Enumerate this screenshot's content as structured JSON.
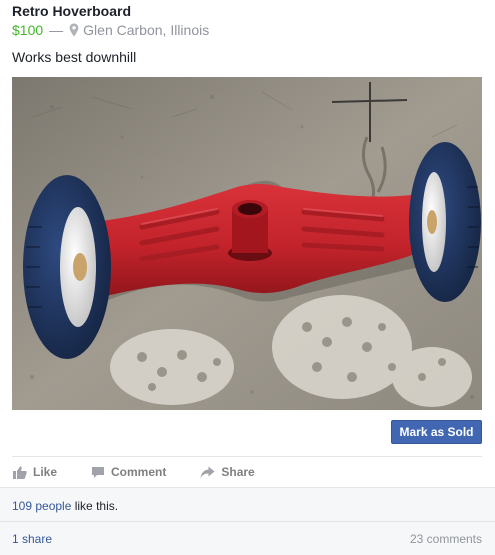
{
  "listing": {
    "title": "Retro Hoverboard",
    "price": "$100",
    "separator": "—",
    "location": "Glen Carbon, Illinois",
    "description": "Works best downhill"
  },
  "mark_sold_label": "Mark as Sold",
  "actions": {
    "like_label": "Like",
    "comment_label": "Comment",
    "share_label": "Share"
  },
  "engagement": {
    "likes_link": "109 people",
    "likes_suffix": " like this.",
    "shares": "1 share",
    "comments": "23 comments"
  },
  "colors": {
    "price": "#42b72a",
    "button": "#4267b2",
    "link": "#365899",
    "muted": "#90949c"
  },
  "icons": [
    "location-pin-icon",
    "thumbs-up-icon",
    "comment-icon",
    "share-icon"
  ]
}
